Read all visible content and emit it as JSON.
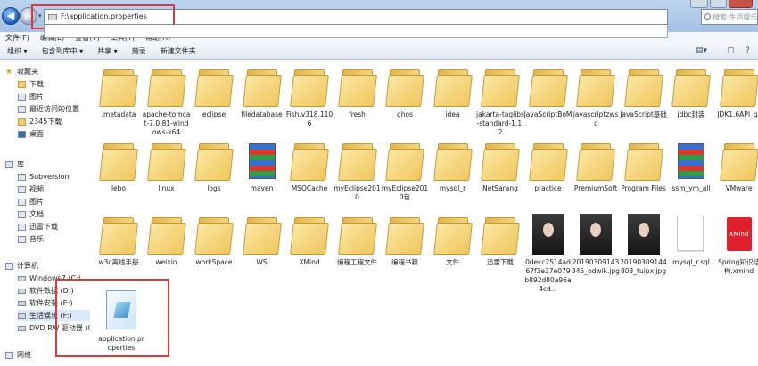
{
  "address": {
    "path": "F:\\application.properties"
  },
  "search": {
    "placeholder": "搜索 生活娱乐"
  },
  "menubar": [
    "文件(F)",
    "编辑(E)",
    "查看(V)",
    "工具(T)",
    "帮助(H)"
  ],
  "toolbar": {
    "organize": "组织 ▾",
    "include": "包含到库中 ▾",
    "share": "共享 ▾",
    "burn": "刻录",
    "new_folder": "新建文件夹"
  },
  "sidebar": {
    "favorites": {
      "title": "收藏夹",
      "items": [
        "下载",
        "图片",
        "最近访问的位置",
        "2345下载",
        "桌面"
      ]
    },
    "libraries": {
      "title": "库",
      "items": [
        "Subversion",
        "视频",
        "图片",
        "文档",
        "迅雷下载",
        "音乐"
      ]
    },
    "computer": {
      "title": "计算机",
      "items": [
        "Windows7 (C:)",
        "软件数据 (D:)",
        "软件安装 (E:)",
        "生活娱乐 (F:)",
        "DVD RW 驱动器 (G"
      ]
    },
    "network": {
      "title": "网络"
    }
  },
  "files": [
    {
      "label": ".metadata",
      "kind": "folder"
    },
    {
      "label": "apache-tomcat-7.0.81-windows-x64",
      "kind": "folder"
    },
    {
      "label": "eclipse",
      "kind": "folder"
    },
    {
      "label": "filedatabase",
      "kind": "folder"
    },
    {
      "label": "Fish.v318.1106",
      "kind": "folder"
    },
    {
      "label": "fresh",
      "kind": "folder"
    },
    {
      "label": "ghos",
      "kind": "folder"
    },
    {
      "label": "idea",
      "kind": "folder"
    },
    {
      "label": "jakarta-taglibs-standard-1.1.2",
      "kind": "folder"
    },
    {
      "label": "JavaScriptBoM",
      "kind": "folder"
    },
    {
      "label": "javascriptzwsc",
      "kind": "folder"
    },
    {
      "label": "JavaScript基础",
      "kind": "folder"
    },
    {
      "label": "jdbc封装",
      "kind": "folder"
    },
    {
      "label": "JDK1.6API_gr",
      "kind": "folder"
    },
    {
      "label": "lebo",
      "kind": "folder"
    },
    {
      "label": "linux",
      "kind": "folder"
    },
    {
      "label": "logs",
      "kind": "folder"
    },
    {
      "label": "maven",
      "kind": "zip"
    },
    {
      "label": "MSOCache",
      "kind": "folder"
    },
    {
      "label": "myEclipse2010",
      "kind": "folder"
    },
    {
      "label": "myEclipse2010包",
      "kind": "folder"
    },
    {
      "label": "mysql_r",
      "kind": "folder"
    },
    {
      "label": "NetSarang",
      "kind": "folder"
    },
    {
      "label": "practice",
      "kind": "folder"
    },
    {
      "label": "PremiumSoft",
      "kind": "folder"
    },
    {
      "label": "Program Files",
      "kind": "folder"
    },
    {
      "label": "ssm_ym_all",
      "kind": "zip"
    },
    {
      "label": "VMware",
      "kind": "folder"
    },
    {
      "label": "w3c离线手册",
      "kind": "folder"
    },
    {
      "label": "weixin",
      "kind": "folder"
    },
    {
      "label": "workSpace",
      "kind": "folder"
    },
    {
      "label": "WS",
      "kind": "folder"
    },
    {
      "label": "XMind",
      "kind": "folder"
    },
    {
      "label": "编程工程文件",
      "kind": "folder"
    },
    {
      "label": "编程书籍",
      "kind": "folder"
    },
    {
      "label": "文件",
      "kind": "folder"
    },
    {
      "label": "迅雷下载",
      "kind": "folder"
    },
    {
      "label": "0decc2514ad67f3e37e079b892d80a96a4cd...",
      "kind": "photo"
    },
    {
      "label": "20190309143345_odwik.jpg",
      "kind": "photo"
    },
    {
      "label": "20190309144803_tuipx.jpg",
      "kind": "photo"
    },
    {
      "label": "mysql_r.sql",
      "kind": "doc"
    },
    {
      "label": "Spring知识结构.xmind",
      "kind": "xmind"
    }
  ],
  "selected_file": {
    "label": "application.properties"
  },
  "xmind_badge": "XMind",
  "colors": {
    "highlight": "#d9393f",
    "folder": "#f0c75d",
    "title_bar": "#bcd3ee"
  }
}
